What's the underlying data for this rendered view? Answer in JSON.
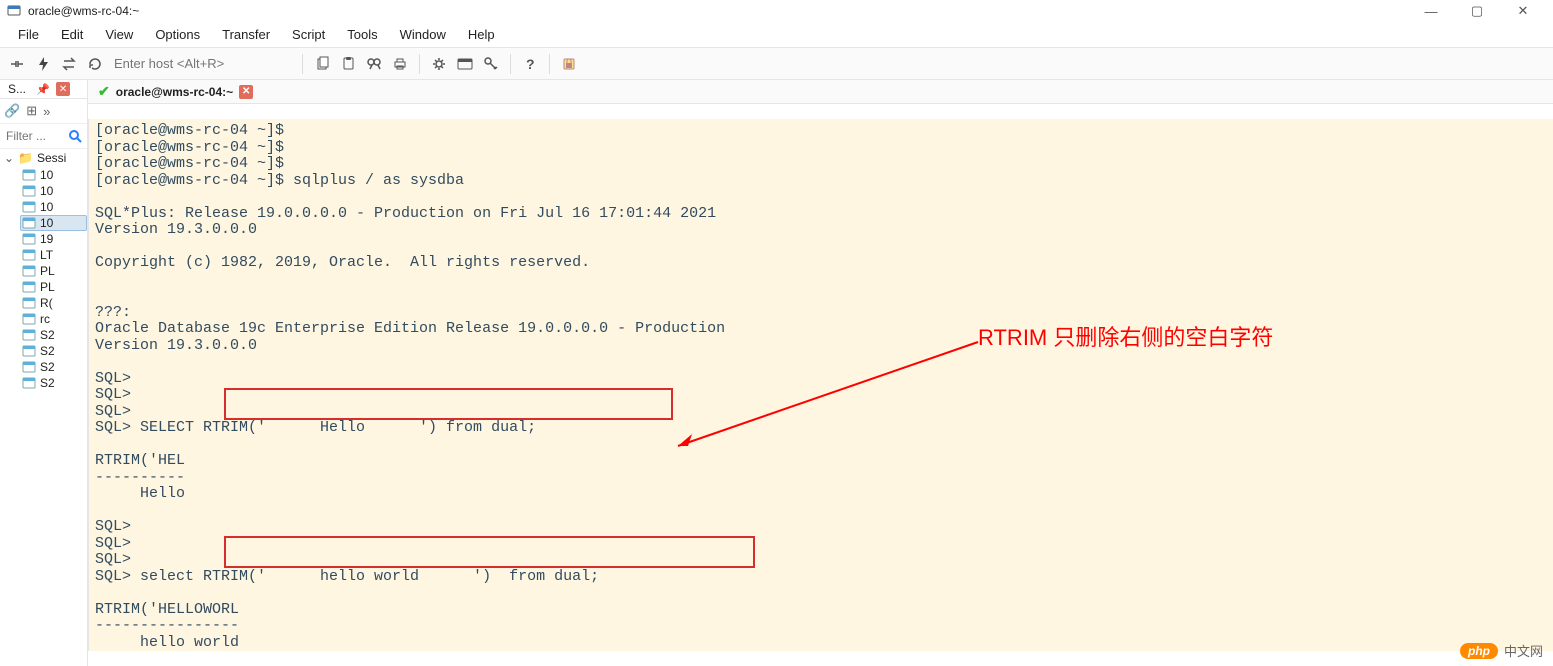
{
  "window": {
    "title": "oracle@wms-rc-04:~",
    "controls": {
      "min": "—",
      "max": "▢",
      "close": "✕"
    }
  },
  "menubar": [
    "File",
    "Edit",
    "View",
    "Options",
    "Transfer",
    "Script",
    "Tools",
    "Window",
    "Help"
  ],
  "toolbar": {
    "host_placeholder": "Enter host <Alt+R>"
  },
  "sidebar": {
    "sessions_tab": "S...",
    "filter_placeholder": "Filter ...",
    "root_label": "Sessi",
    "items": [
      {
        "label": "10",
        "selected": false
      },
      {
        "label": "10",
        "selected": false
      },
      {
        "label": "10",
        "selected": false
      },
      {
        "label": "10",
        "selected": true
      },
      {
        "label": "19",
        "selected": false
      },
      {
        "label": "LT",
        "selected": false
      },
      {
        "label": "PL",
        "selected": false
      },
      {
        "label": "PL",
        "selected": false
      },
      {
        "label": "R(",
        "selected": false
      },
      {
        "label": "rc",
        "selected": false
      },
      {
        "label": "S2",
        "selected": false
      },
      {
        "label": "S2",
        "selected": false
      },
      {
        "label": "S2",
        "selected": false
      },
      {
        "label": "S2",
        "selected": false
      }
    ]
  },
  "tab": {
    "title": "oracle@wms-rc-04:~"
  },
  "terminal": {
    "text": "[oracle@wms-rc-04 ~]$\n[oracle@wms-rc-04 ~]$\n[oracle@wms-rc-04 ~]$\n[oracle@wms-rc-04 ~]$ sqlplus / as sysdba\n\nSQL*Plus: Release 19.0.0.0.0 - Production on Fri Jul 16 17:01:44 2021\nVersion 19.3.0.0.0\n\nCopyright (c) 1982, 2019, Oracle.  All rights reserved.\n\n\n???:\nOracle Database 19c Enterprise Edition Release 19.0.0.0.0 - Production\nVersion 19.3.0.0.0\n\nSQL>\nSQL>\nSQL>\nSQL> SELECT RTRIM('      Hello      ') from dual;\n\nRTRIM('HEL\n----------\n     Hello\n\nSQL>\nSQL>\nSQL>\nSQL> select RTRIM('      hello world      ')  from dual;\n\nRTRIM('HELLOWORL\n----------------\n     hello world\n"
  },
  "annotation": {
    "text": "RTRIM 只删除右侧的空白字符"
  },
  "watermark": {
    "badge": "php",
    "text": "中文网"
  }
}
